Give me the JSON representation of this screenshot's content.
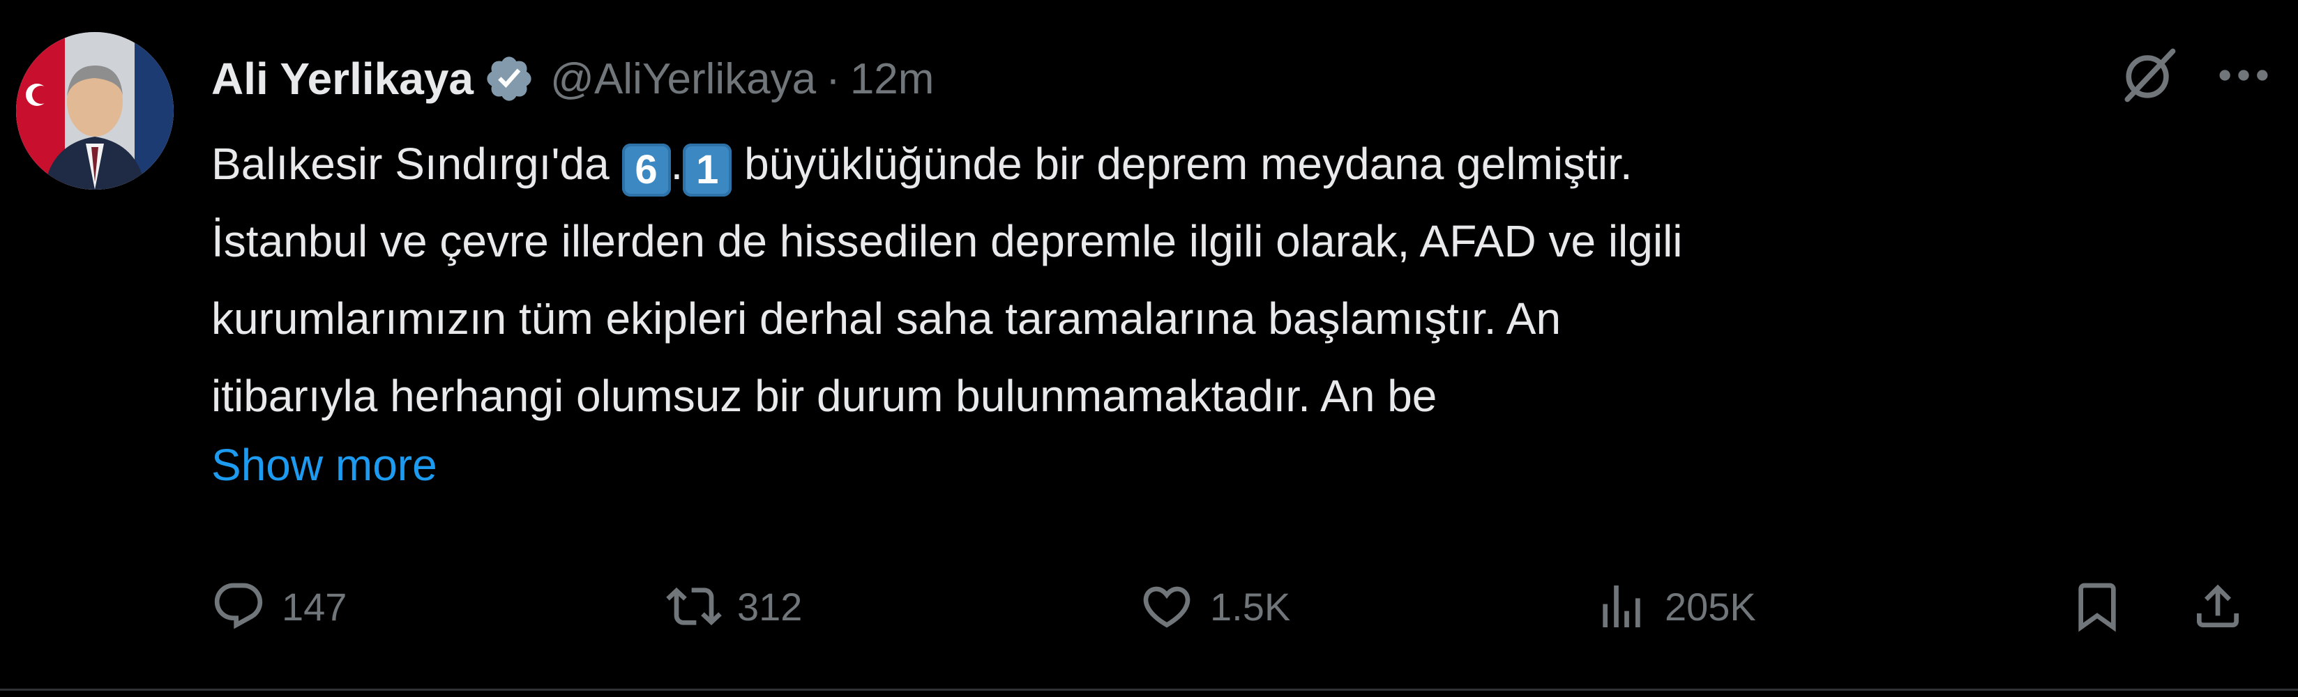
{
  "author": {
    "name": "Ali Yerlikaya",
    "handle": "@AliYerlikaya",
    "separator": "·",
    "time": "12m",
    "verified": true
  },
  "tweet": {
    "line1_prefix": "Balıkesir Sındırgı'da ",
    "magnitude_digit1": "6",
    "magnitude_dot": ".",
    "magnitude_digit2": "1",
    "line1_suffix": " büyüklüğünde bir deprem meydana gelmiştir.",
    "line2": "İstanbul ve çevre illerden de hissedilen depremle ilgili olarak, AFAD ve ilgili",
    "line3": "kurumlarımızın tüm ekipleri derhal saha taramalarına başlamıştır. An",
    "line4": "itibarıyla herhangi olumsuz bir durum bulunmamaktadır. An be",
    "show_more": "Show more"
  },
  "metrics": {
    "replies": "147",
    "reposts": "312",
    "likes": "1.5K",
    "views": "205K"
  },
  "colors": {
    "background": "#000000",
    "text": "#e7e9ea",
    "secondary": "#71767b",
    "link": "#1d9bf0",
    "verified_badge": "#829aab",
    "keycap": "#3b88c3"
  },
  "icons": {
    "verified": "verified-badge-icon",
    "grok": "grok-icon",
    "more": "more-options-icon",
    "reply": "reply-icon",
    "repost": "repost-icon",
    "like": "like-icon",
    "views": "views-icon",
    "bookmark": "bookmark-icon",
    "share": "share-icon"
  }
}
